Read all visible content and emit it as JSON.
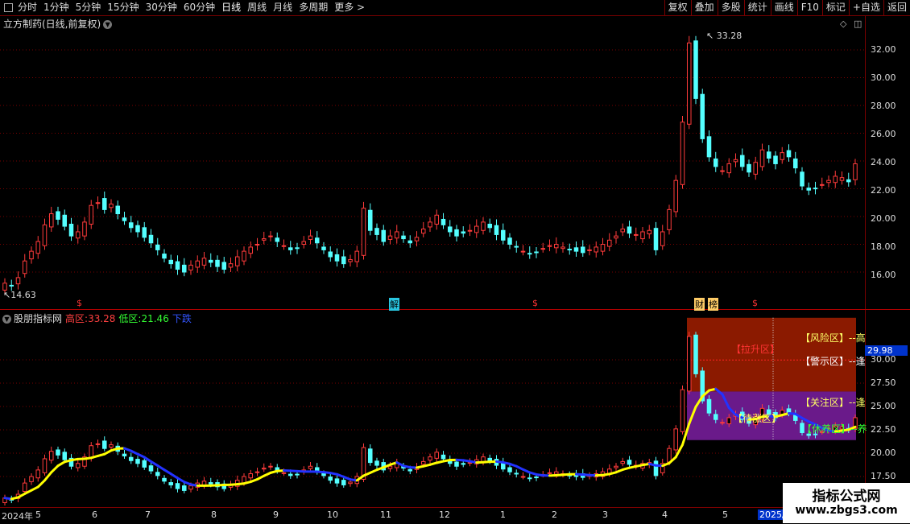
{
  "toolbar": {
    "periods": [
      "分时",
      "1分钟",
      "5分钟",
      "15分钟",
      "30分钟",
      "60分钟",
      "日线",
      "周线",
      "月线",
      "多周期",
      "更多 >"
    ],
    "active_period": "日线",
    "right_buttons": [
      "复权",
      "叠加",
      "多股",
      "统计",
      "画线",
      "F10",
      "标记",
      "+自选",
      "返回"
    ]
  },
  "main_chart": {
    "title": "立方制药(日线,前复权)",
    "high_label": "33.28",
    "low_label": "14.63",
    "y_ticks": [
      "32.00",
      "30.00",
      "28.00",
      "26.00",
      "24.00",
      "22.00",
      "20.00",
      "18.00",
      "16.00"
    ],
    "event_markers": [
      "$",
      "解",
      "$",
      "财",
      "榜",
      "$"
    ]
  },
  "indicator": {
    "name": "股朋指标网",
    "high_zone_label": "高区:",
    "high_zone_value": "33.28",
    "low_zone_label": "低区:",
    "low_zone_value": "21.46",
    "trend": "下跌",
    "y_ticks": [
      "30.00",
      "27.50",
      "25.00",
      "22.50",
      "20.00",
      "17.50"
    ],
    "current_price": "29.98",
    "zones": {
      "risk": "【风险区】--高",
      "lift": "【拉升区】",
      "warn": "【警示区】--逢",
      "focus": "【关注区】--逢",
      "wait": "【待涨区】",
      "rest": "【休养区】--养"
    }
  },
  "date_axis": [
    "2024年",
    "5",
    "6",
    "7",
    "8",
    "9",
    "10",
    "11",
    "12",
    "1",
    "2",
    "3",
    "4",
    "5",
    "2025/"
  ],
  "watermark": {
    "line1": "指标公式网",
    "line2": "www.zbgs3.com"
  },
  "colors": {
    "up": "#ff3b3b",
    "down": "#54ffff",
    "grid": "#7a0000",
    "ma_up": "#ffff00",
    "ma_down": "#2233ff",
    "risk_zone": "#8b1a00",
    "focus_zone": "#6a1a8a"
  },
  "chart_data": {
    "type": "candlestick",
    "series_close": [
      15.2,
      15.0,
      15.6,
      16.8,
      17.5,
      18.2,
      19.4,
      20.2,
      19.8,
      19.3,
      18.6,
      18.9,
      19.6,
      20.8,
      21.0,
      20.5,
      20.9,
      20.2,
      19.7,
      19.2,
      18.9,
      18.5,
      18.1,
      17.6,
      17.0,
      16.6,
      16.2,
      16.0,
      16.5,
      16.8,
      17.0,
      16.7,
      16.4,
      16.2,
      16.6,
      17.1,
      17.5,
      17.8,
      18.0,
      18.4,
      18.6,
      18.2,
      17.9,
      17.6,
      17.7,
      18.2,
      18.6,
      18.1,
      17.6,
      17.1,
      16.8,
      16.6,
      16.9,
      17.5,
      20.6,
      19.0,
      18.7,
      18.2,
      18.6,
      18.9,
      18.4,
      18.1,
      18.5,
      19.1,
      19.6,
      20.1,
      19.4,
      18.9,
      18.6,
      18.8,
      19.0,
      19.3,
      19.6,
      19.2,
      18.7,
      18.3,
      18.0,
      17.8,
      17.5,
      17.3,
      17.4,
      17.7,
      17.9,
      18.0,
      17.8,
      17.6,
      17.5,
      17.4,
      17.6,
      17.8,
      18.0,
      18.3,
      18.6,
      19.1,
      18.8,
      18.7,
      18.9,
      19.0,
      17.6,
      18.9,
      20.5,
      22.6,
      26.8,
      32.5,
      28.5,
      25.6,
      24.3,
      23.6,
      23.3,
      23.8,
      24.1,
      23.6,
      23.2,
      23.9,
      24.8,
      24.2,
      23.8,
      24.6,
      24.3,
      23.5,
      22.2,
      21.9,
      22.0,
      22.3,
      22.6,
      22.9,
      22.8,
      22.5,
      23.8
    ],
    "ylim_main": [
      14.63,
      33.28
    ],
    "ylim_indicator": [
      17.0,
      31.0
    ]
  }
}
